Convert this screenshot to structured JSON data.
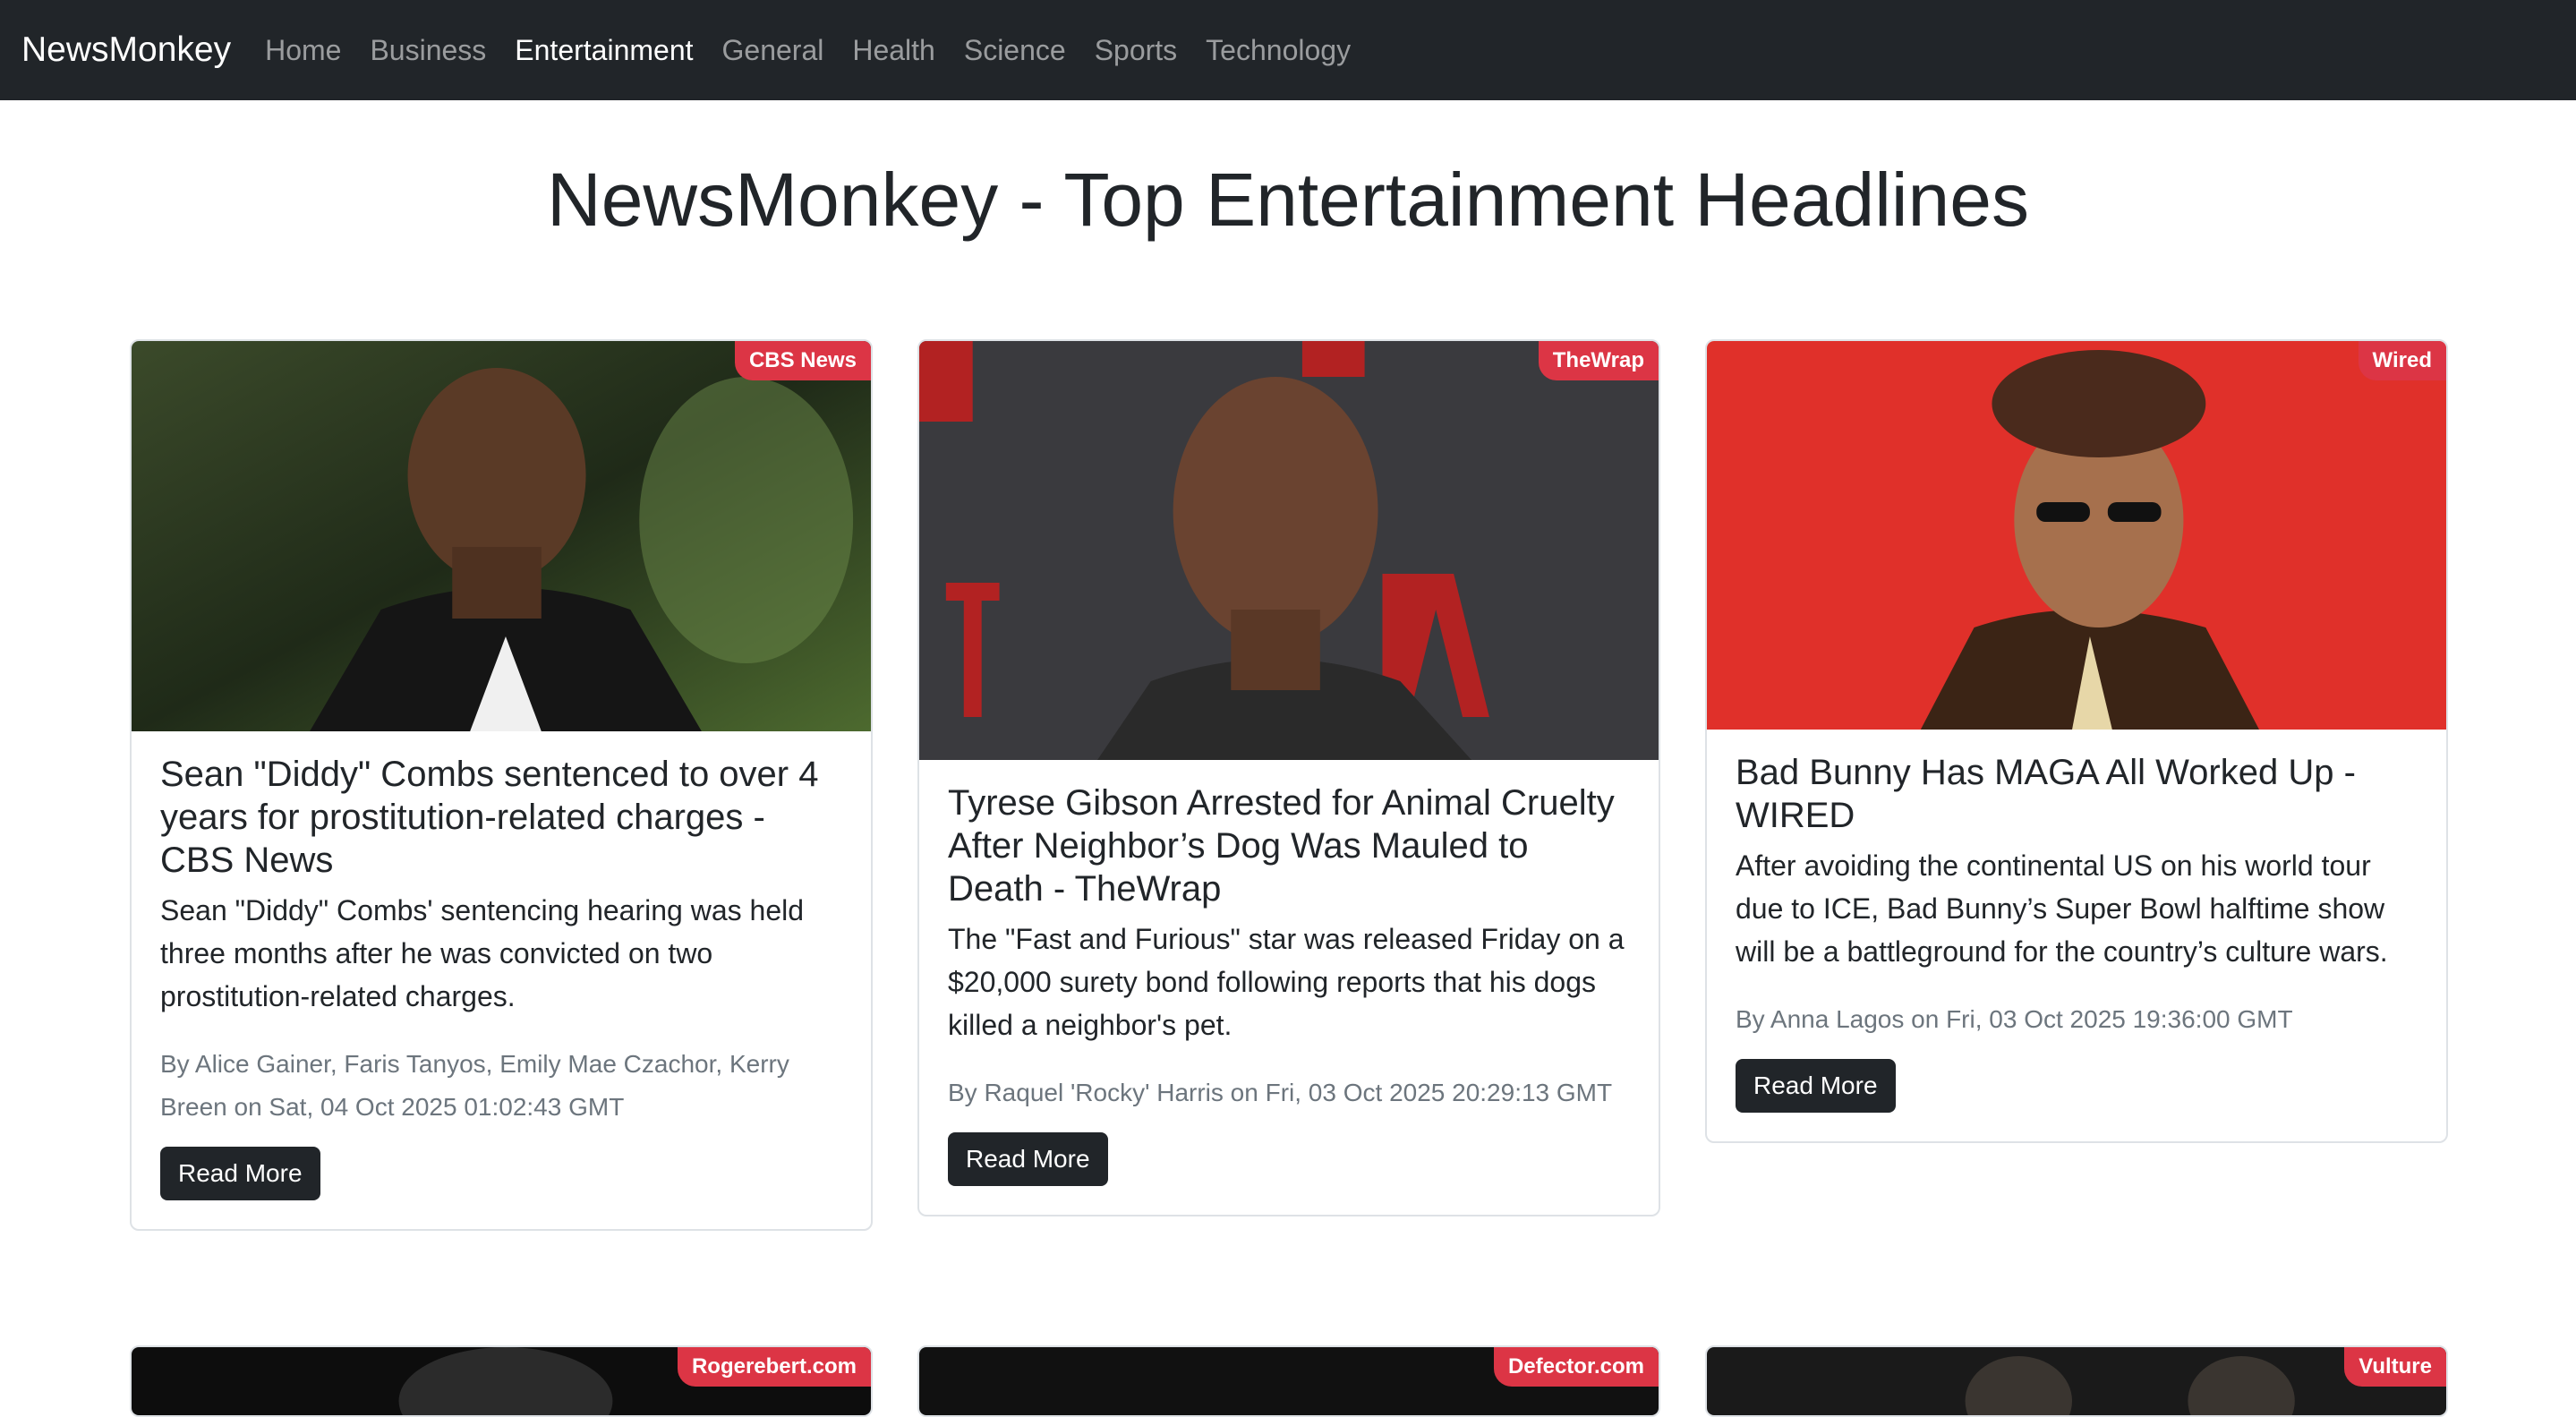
{
  "nav": {
    "brand": "NewsMonkey",
    "items": [
      {
        "label": "Home",
        "active": false
      },
      {
        "label": "Business",
        "active": false
      },
      {
        "label": "Entertainment",
        "active": true
      },
      {
        "label": "General",
        "active": false
      },
      {
        "label": "Health",
        "active": false
      },
      {
        "label": "Science",
        "active": false
      },
      {
        "label": "Sports",
        "active": false
      },
      {
        "label": "Technology",
        "active": false
      }
    ]
  },
  "page": {
    "title": "NewsMonkey - Top Entertainment Headlines"
  },
  "articles": [
    {
      "source": "CBS News",
      "title": "Sean \"Diddy\" Combs sentenced to over 4 years for prostitution-related charges - CBS News",
      "description": "Sean \"Diddy\" Combs' sentencing hearing was held three months after he was convicted on two prostitution-related charges.",
      "meta": "By Alice Gainer, Faris Tanyos, Emily Mae Czachor, Kerry Breen on Sat, 04 Oct 2025 01:02:43 GMT",
      "button": "Read More"
    },
    {
      "source": "TheWrap",
      "title": "Tyrese Gibson Arrested for Animal Cruelty After Neighbor’s Dog Was Mauled to Death - TheWrap",
      "description": "The \"Fast and Furious\" star was released Friday on a $20,000 surety bond following reports that his dogs killed a neighbor's pet.",
      "meta": "By Raquel 'Rocky' Harris on Fri, 03 Oct 2025 20:29:13 GMT",
      "button": "Read More"
    },
    {
      "source": "Wired",
      "title": "Bad Bunny Has MAGA All Worked Up - WIRED",
      "description": "After avoiding the continental US on his world tour due to ICE, Bad Bunny’s Super Bowl halftime show will be a battleground for the country’s culture wars.",
      "meta": "By Anna Lagos on Fri, 03 Oct 2025 19:36:00 GMT",
      "button": "Read More"
    },
    {
      "source": "Rogerebert.com"
    },
    {
      "source": "Defector.com"
    },
    {
      "source": "Vulture"
    }
  ],
  "colors": {
    "nav_bg": "#212529",
    "badge": "#dc3545",
    "button": "#212529"
  }
}
